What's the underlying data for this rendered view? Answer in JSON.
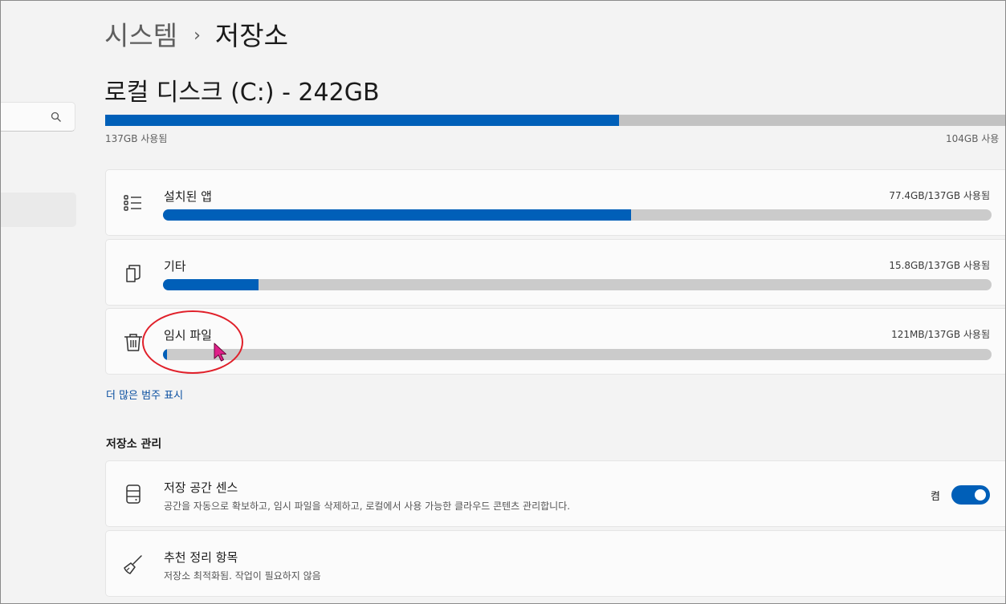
{
  "breadcrumb": {
    "parent": "시스템",
    "separator": "›",
    "current": "저장소"
  },
  "disk": {
    "title": "로컬 디스크 (C:) - 242GB",
    "used_label": "137GB 사용됨",
    "free_label": "104GB 사용",
    "used_fraction": 0.5661
  },
  "categories": [
    {
      "label": "설치된 앱",
      "size": "77.4GB/137GB 사용됨",
      "fraction": 0.565,
      "icon": "list-icon"
    },
    {
      "label": "기타",
      "size": "15.8GB/137GB 사용됨",
      "fraction": 0.115,
      "icon": "document-icon"
    },
    {
      "label": "임시 파일",
      "size": "121MB/137GB 사용됨",
      "fraction": 0.003,
      "icon": "trash-icon"
    }
  ],
  "more_link": "더 많은 범주 표시",
  "management": {
    "title": "저장소 관리",
    "sense": {
      "label": "저장 공간 센스",
      "description": "공간을 자동으로 확보하고, 임시 파일을 삭제하고, 로컬에서 사용 가능한 클라우드 콘텐츠 관리합니다.",
      "toggle_state": "켬",
      "toggle_on": true
    },
    "cleanup": {
      "label": "추천 정리 항목",
      "description": "저장소 최적화됨. 작업이 필요하지 않음"
    }
  },
  "colors": {
    "accent": "#005fb8",
    "annotation": "#e0202a",
    "cursor": "#e0208a"
  }
}
